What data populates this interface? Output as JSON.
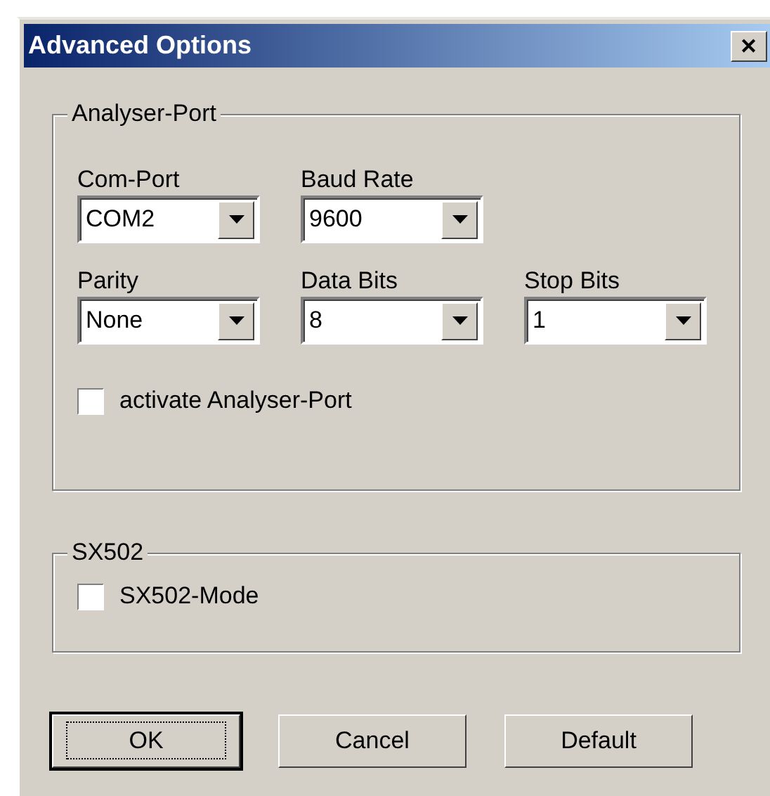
{
  "window": {
    "title": "Advanced Options",
    "close": "✕"
  },
  "groups": [
    {
      "title": "Analyser-Port",
      "rows": [
        [
          {
            "label": "Com-Port",
            "value": "COM2"
          },
          {
            "label": "Baud Rate",
            "value": "9600"
          }
        ],
        [
          {
            "label": "Parity",
            "value": "None"
          },
          {
            "label": "Data Bits",
            "value": "8"
          },
          {
            "label": "Stop Bits",
            "value": "1"
          }
        ]
      ],
      "checkbox": {
        "label": "activate Analyser-Port",
        "checked": false
      }
    },
    {
      "title": "SX502",
      "checkbox": {
        "label": "SX502-Mode",
        "checked": false
      }
    }
  ],
  "buttons": [
    {
      "label": "OK",
      "default": true
    },
    {
      "label": "Cancel",
      "default": false
    },
    {
      "label": "Default",
      "default": false
    }
  ]
}
